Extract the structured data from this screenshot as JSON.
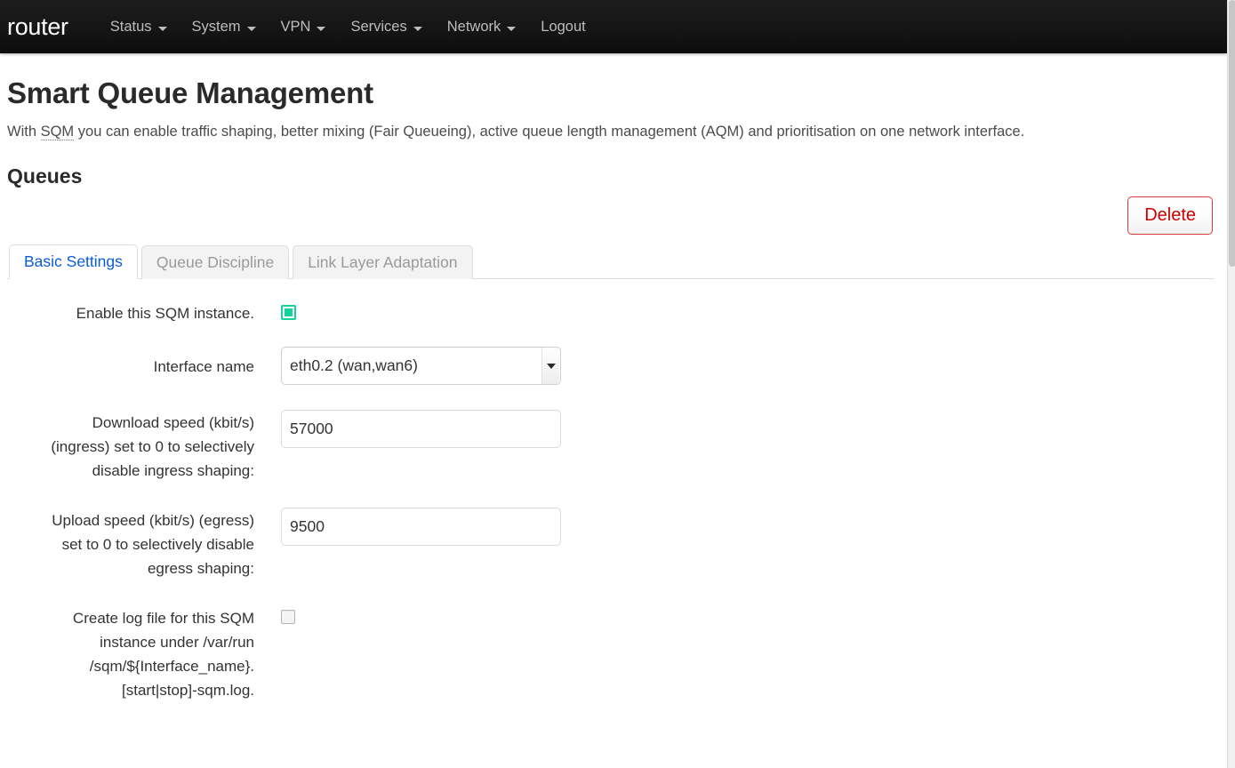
{
  "navbar": {
    "brand": "router",
    "items": [
      {
        "label": "Status",
        "has_caret": true,
        "icon": "chevron-down-icon"
      },
      {
        "label": "System",
        "has_caret": true,
        "icon": "chevron-down-icon"
      },
      {
        "label": "VPN",
        "has_caret": true,
        "icon": "chevron-down-icon"
      },
      {
        "label": "Services",
        "has_caret": true,
        "icon": "chevron-down-icon"
      },
      {
        "label": "Network",
        "has_caret": true,
        "icon": "chevron-down-icon"
      },
      {
        "label": "Logout",
        "has_caret": false,
        "icon": ""
      }
    ]
  },
  "page": {
    "title": "Smart Queue Management",
    "description_before": "With ",
    "description_abbr": "SQM",
    "description_after": " you can enable traffic shaping, better mixing (Fair Queueing), active queue length management (AQM) and prioritisation on one network interface.",
    "section_title": "Queues"
  },
  "actions": {
    "delete_label": "Delete",
    "delete_color": "#cc0000",
    "delete_border_color": "#d83b3b"
  },
  "tabs": [
    {
      "label": "Basic Settings",
      "active": true,
      "name": "tab-basic-settings"
    },
    {
      "label": "Queue Discipline",
      "active": false,
      "name": "tab-queue-discipline"
    },
    {
      "label": "Link Layer Adaptation",
      "active": false,
      "name": "tab-link-layer-adaptation"
    }
  ],
  "tab_colors": {
    "active_text": "#0a5cd8",
    "inactive_text": "#9a9a9a"
  },
  "form": {
    "enable": {
      "label": "Enable this SQM instance.",
      "checked": true,
      "accent": "#16d29e"
    },
    "interface": {
      "label": "Interface name",
      "value": "eth0.2 (wan,wan6)",
      "options": [
        "eth0.2 (wan,wan6)"
      ]
    },
    "download": {
      "label": "Download speed (kbit/s) (ingress) set to 0 to selectively disable ingress shaping:",
      "label_lines": [
        "Download speed (kbit/s)",
        "(ingress) set to 0 to selectively",
        "disable ingress shaping:"
      ],
      "value": "57000",
      "placeholder": ""
    },
    "upload": {
      "label": "Upload speed (kbit/s) (egress) set to 0 to selectively disable egress shaping:",
      "label_lines": [
        "Upload speed (kbit/s) (egress)",
        "set to 0 to selectively disable",
        "egress shaping:"
      ],
      "value": "9500",
      "placeholder": ""
    },
    "logfile": {
      "label": "Create log file for this SQM instance under /var/run/sqm/${Interface_name}.[start|stop]-sqm.log.",
      "label_lines": [
        "Create log file for this SQM",
        "instance under /var/run",
        "/sqm/${Interface_name}.",
        "[start|stop]-sqm.log."
      ],
      "checked": false
    }
  }
}
